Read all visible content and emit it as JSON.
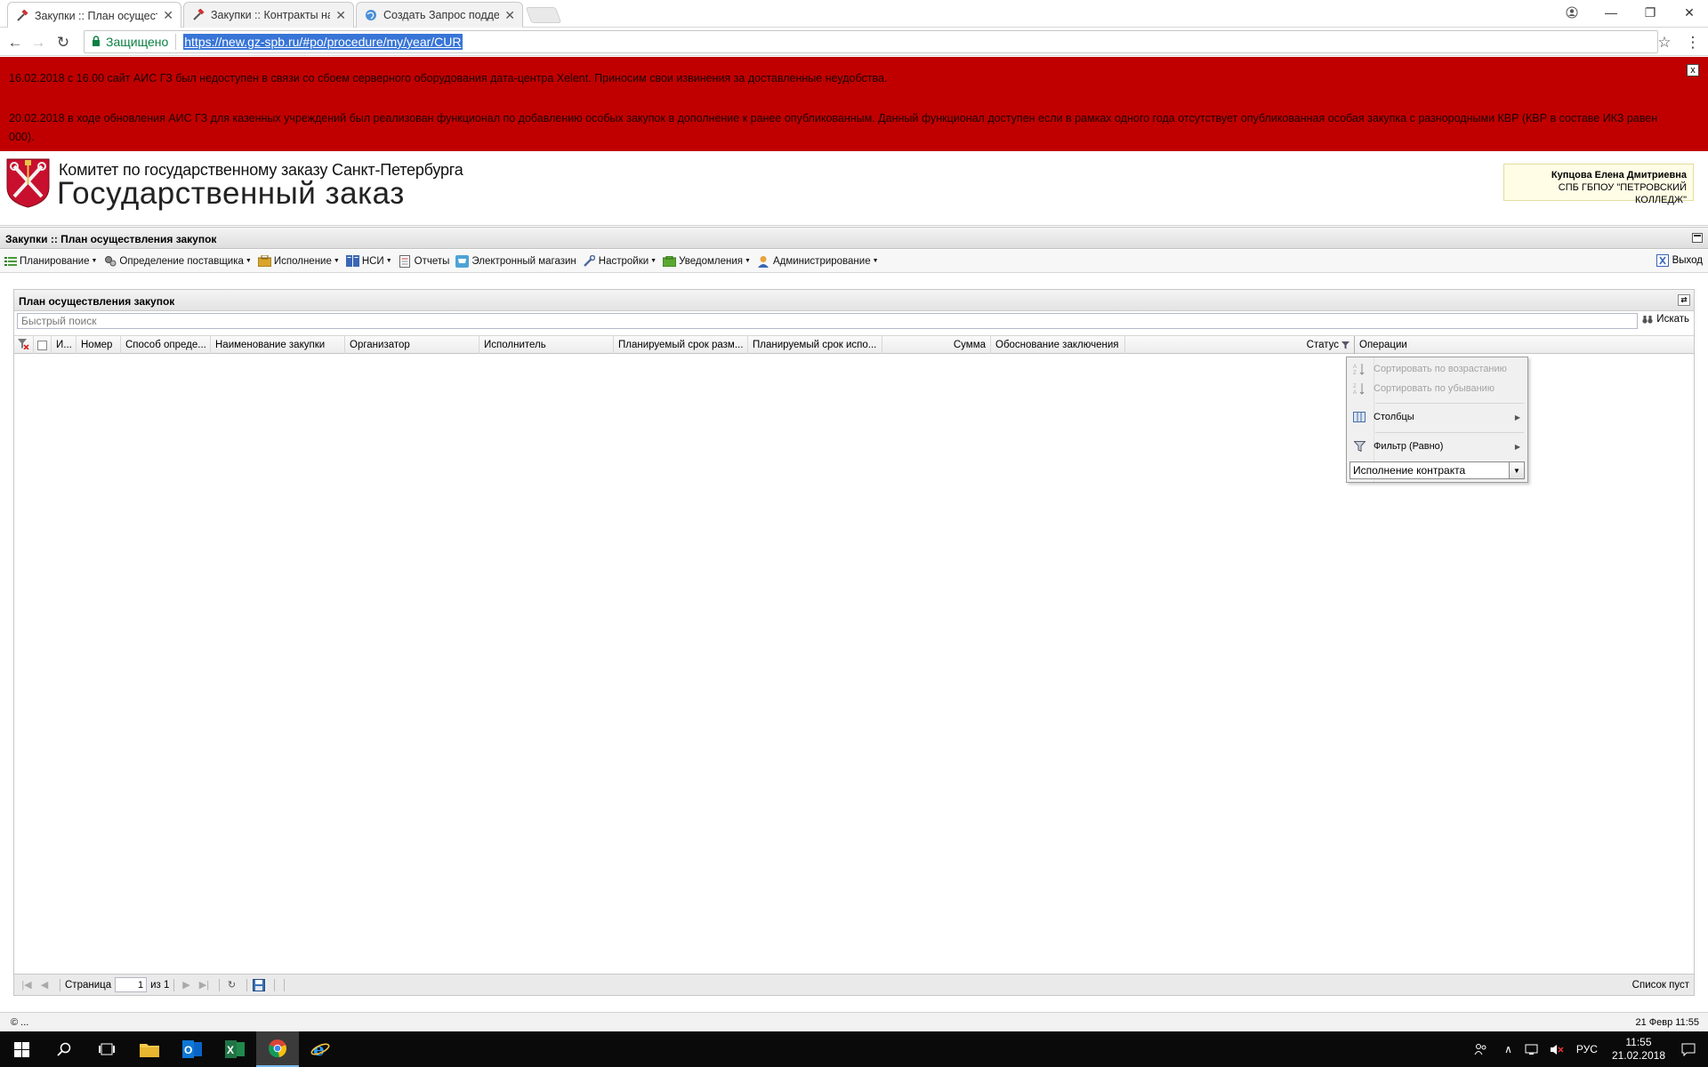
{
  "browser": {
    "tabs": [
      {
        "title": "Закупки :: План осущест",
        "active": true
      },
      {
        "title": "Закупки :: Контракты на",
        "active": false
      },
      {
        "title": "Создать Запрос поддерж",
        "active": false
      }
    ],
    "secure_label": "Защищено",
    "url": "https://new.gz-spb.ru/#po/procedure/my/year/CUR"
  },
  "alert": {
    "message1": "16.02.2018 с 16.00 сайт АИС ГЗ был недоступен в связи со сбоем серверного оборудования дата-центра Xelent. Приносим свои извинения за доставленные неудобства.",
    "message2": "20.02.2018 в ходе обновления АИС ГЗ для казенных учреждений был реализован функционал по добавлению особых закупок в дополнение к ранее опубликованным. Данный функционал доступен если в рамках одного года отсутствует опубликованная особая закупка с разнородными КВР (КВР в составе ИКЗ равен 000).",
    "close_label": "x"
  },
  "header": {
    "committee": "Комитет по государственному заказу Санкт-Петербурга",
    "title": "Государственный заказ",
    "user_name": "Купцова Елена Дмитриевна",
    "user_org": "СПБ ГБПОУ \"ПЕТРОВСКИЙ КОЛЛЕДЖ\""
  },
  "panel": {
    "title": "Закупки :: План осуществления закупок"
  },
  "menu": {
    "items": [
      {
        "label": "Планирование",
        "icon": "planning-icon",
        "dropdown": true
      },
      {
        "label": "Определение поставщика",
        "icon": "supplier-icon",
        "dropdown": true
      },
      {
        "label": "Исполнение",
        "icon": "execution-icon",
        "dropdown": true
      },
      {
        "label": "НСИ",
        "icon": "book-icon",
        "dropdown": true
      },
      {
        "label": "Отчеты",
        "icon": "report-icon",
        "dropdown": false
      },
      {
        "label": "Электронный магазин",
        "icon": "shop-icon",
        "dropdown": false
      },
      {
        "label": "Настройки",
        "icon": "wrench-icon",
        "dropdown": true
      },
      {
        "label": "Уведомления",
        "icon": "notification-icon",
        "dropdown": true
      },
      {
        "label": "Администрирование",
        "icon": "user-admin-icon",
        "dropdown": true
      }
    ],
    "exit_label": "Выход"
  },
  "grid": {
    "title": "План осуществления закупок",
    "search_placeholder": "Быстрый поиск",
    "search_button": "Искать",
    "columns": [
      "И...",
      "Номер",
      "Способ опреде...",
      "Наименование закупки",
      "Организатор",
      "Исполнитель",
      "Планируемый срок разм...",
      "Планируемый срок испо...",
      "Сумма",
      "Обоснование заключения",
      "Статус",
      "Операции"
    ],
    "rows": [],
    "pager": {
      "page_label": "Страница",
      "page_value": "1",
      "of_label": "из 1",
      "empty_text": "Список пуст"
    }
  },
  "column_menu": {
    "sort_asc": "Сортировать по возрастанию",
    "sort_desc": "Сортировать по убыванию",
    "columns": "Столбцы",
    "filter": "Фильтр (Равно)",
    "filter_value": "Исполнение контракта"
  },
  "statusline": {
    "left": "© ...",
    "right": "21 Февр 11:55"
  },
  "taskbar": {
    "language": "РУС",
    "time": "11:55",
    "date": "21.02.2018"
  },
  "colors": {
    "alert_bg": "#c00000",
    "url_highlight": "#3875d7",
    "secure_green": "#0b8043"
  }
}
